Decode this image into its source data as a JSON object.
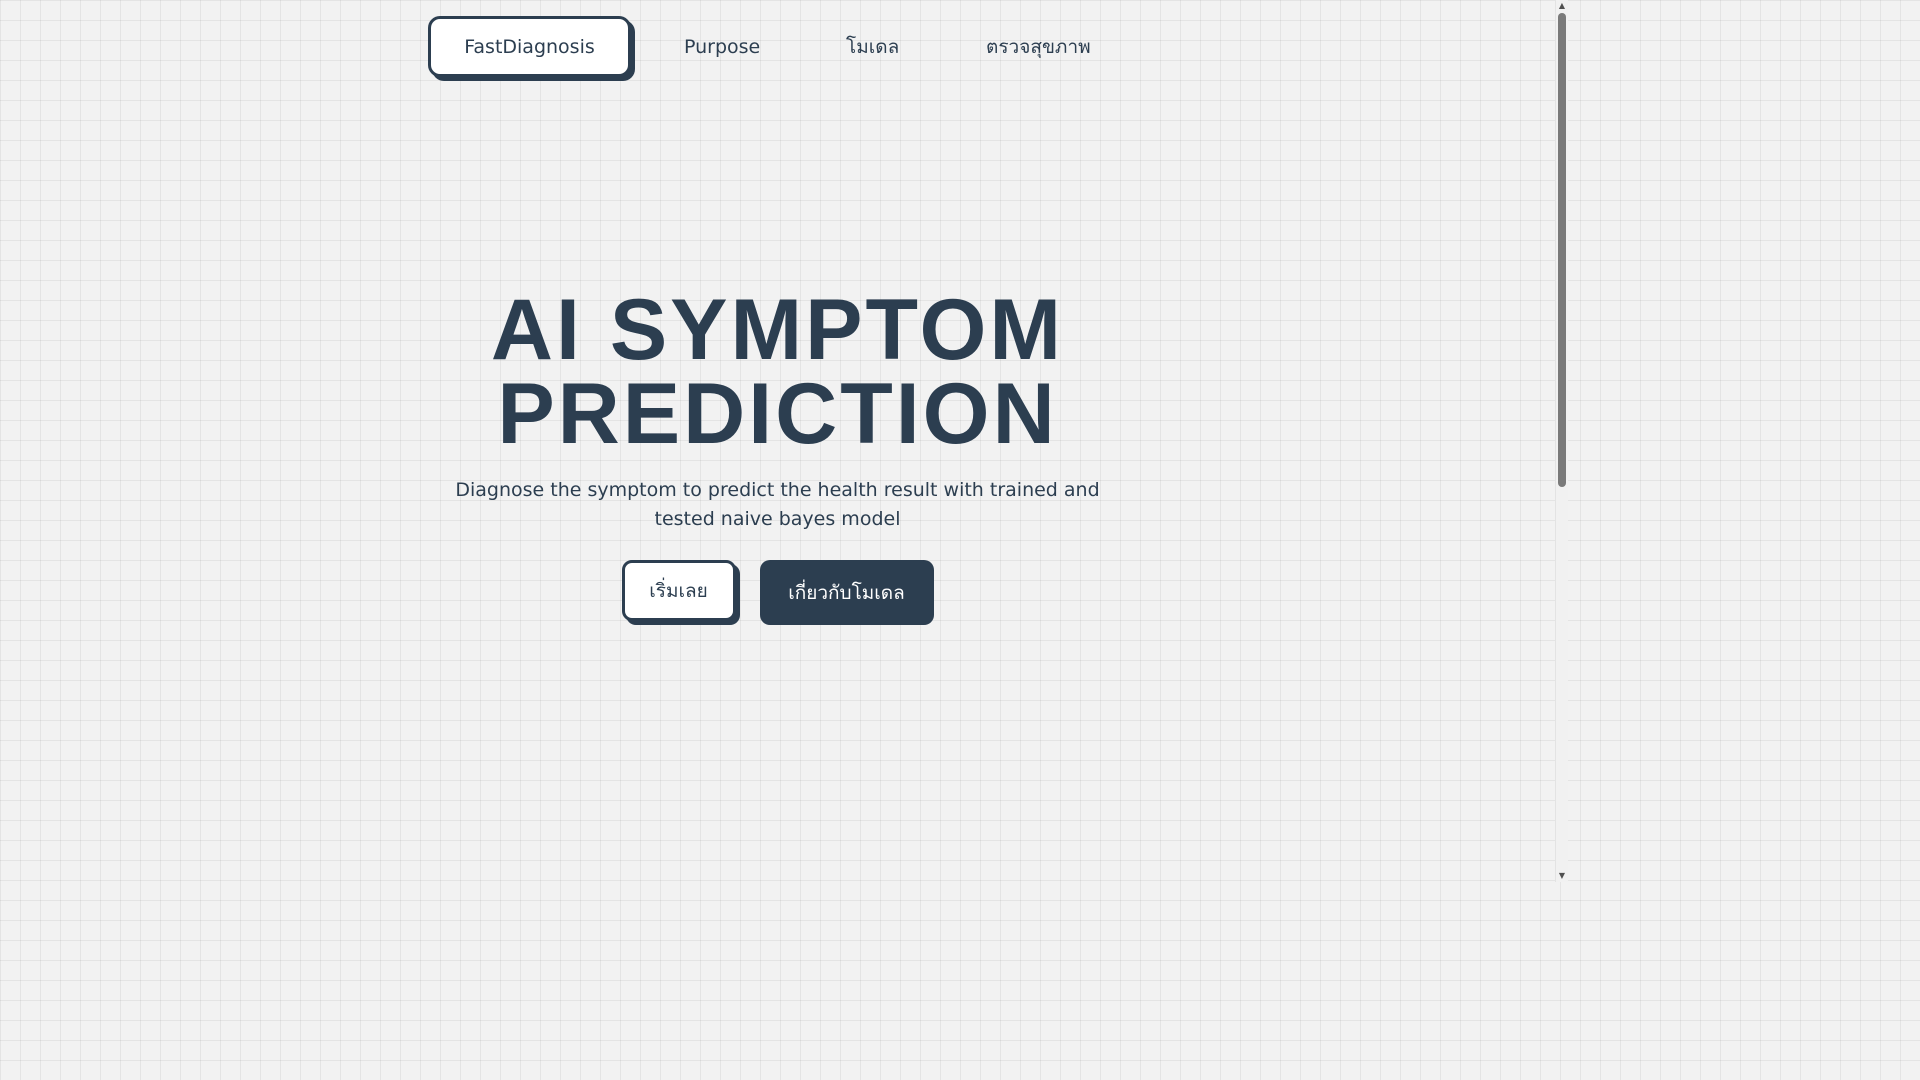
{
  "nav": {
    "brand": "FastDiagnosis",
    "links": [
      {
        "label": "Purpose"
      },
      {
        "label": "โมเดล"
      },
      {
        "label": "ตรวจสุขภาพ"
      }
    ]
  },
  "hero": {
    "title_line1": "AI SYMPTOM",
    "title_line2": "PREDICTION",
    "subtitle": "Diagnose the symptom to predict the health result with trained and tested naive bayes model"
  },
  "cta": {
    "start_label": "เริ่มเลย",
    "about_label": "เกี่ยวกับโมเดล"
  },
  "scrollbar": {
    "up_icon": "▲",
    "down_icon": "▼"
  },
  "colors": {
    "primary": "#2c3e50",
    "background": "#f2f2f2",
    "button_light": "#ffffff"
  }
}
